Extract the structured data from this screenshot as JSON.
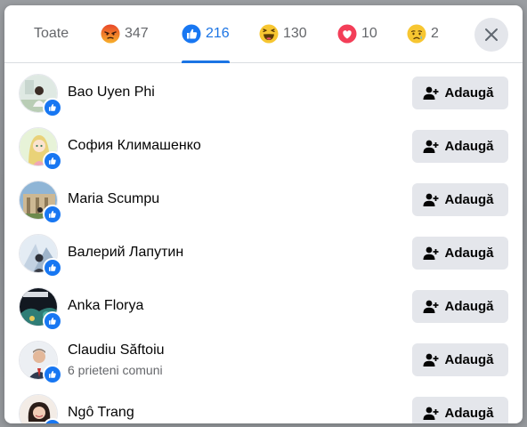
{
  "tabs": [
    {
      "label": "Toate",
      "icon": "all"
    },
    {
      "label": "347",
      "icon": "angry-reaction-icon"
    },
    {
      "label": "216",
      "icon": "like-reaction-icon",
      "active": true
    },
    {
      "label": "130",
      "icon": "haha-reaction-icon"
    },
    {
      "label": "10",
      "icon": "love-reaction-icon"
    },
    {
      "label": "2",
      "icon": "sad-reaction-icon"
    }
  ],
  "colors": {
    "accent": "#1b74e4",
    "like": "#1877f2",
    "button_bg": "#e4e6eb",
    "secondary_text": "#65676b"
  },
  "people": [
    {
      "name": "Bao Uyen Phi",
      "mutual": "",
      "button": "Adaugă"
    },
    {
      "name": "София Климашенко",
      "mutual": "",
      "button": "Adaugă"
    },
    {
      "name": "Maria Scumpu",
      "mutual": "",
      "button": "Adaugă"
    },
    {
      "name": "Валерий Лапутин",
      "mutual": "",
      "button": "Adaugă"
    },
    {
      "name": "Anka Florya",
      "mutual": "",
      "button": "Adaugă"
    },
    {
      "name": "Claudiu Săftoiu",
      "mutual": "6 prieteni comuni",
      "button": "Adaugă"
    },
    {
      "name": "Ngô Trang",
      "mutual": "",
      "button": "Adaugă"
    }
  ]
}
